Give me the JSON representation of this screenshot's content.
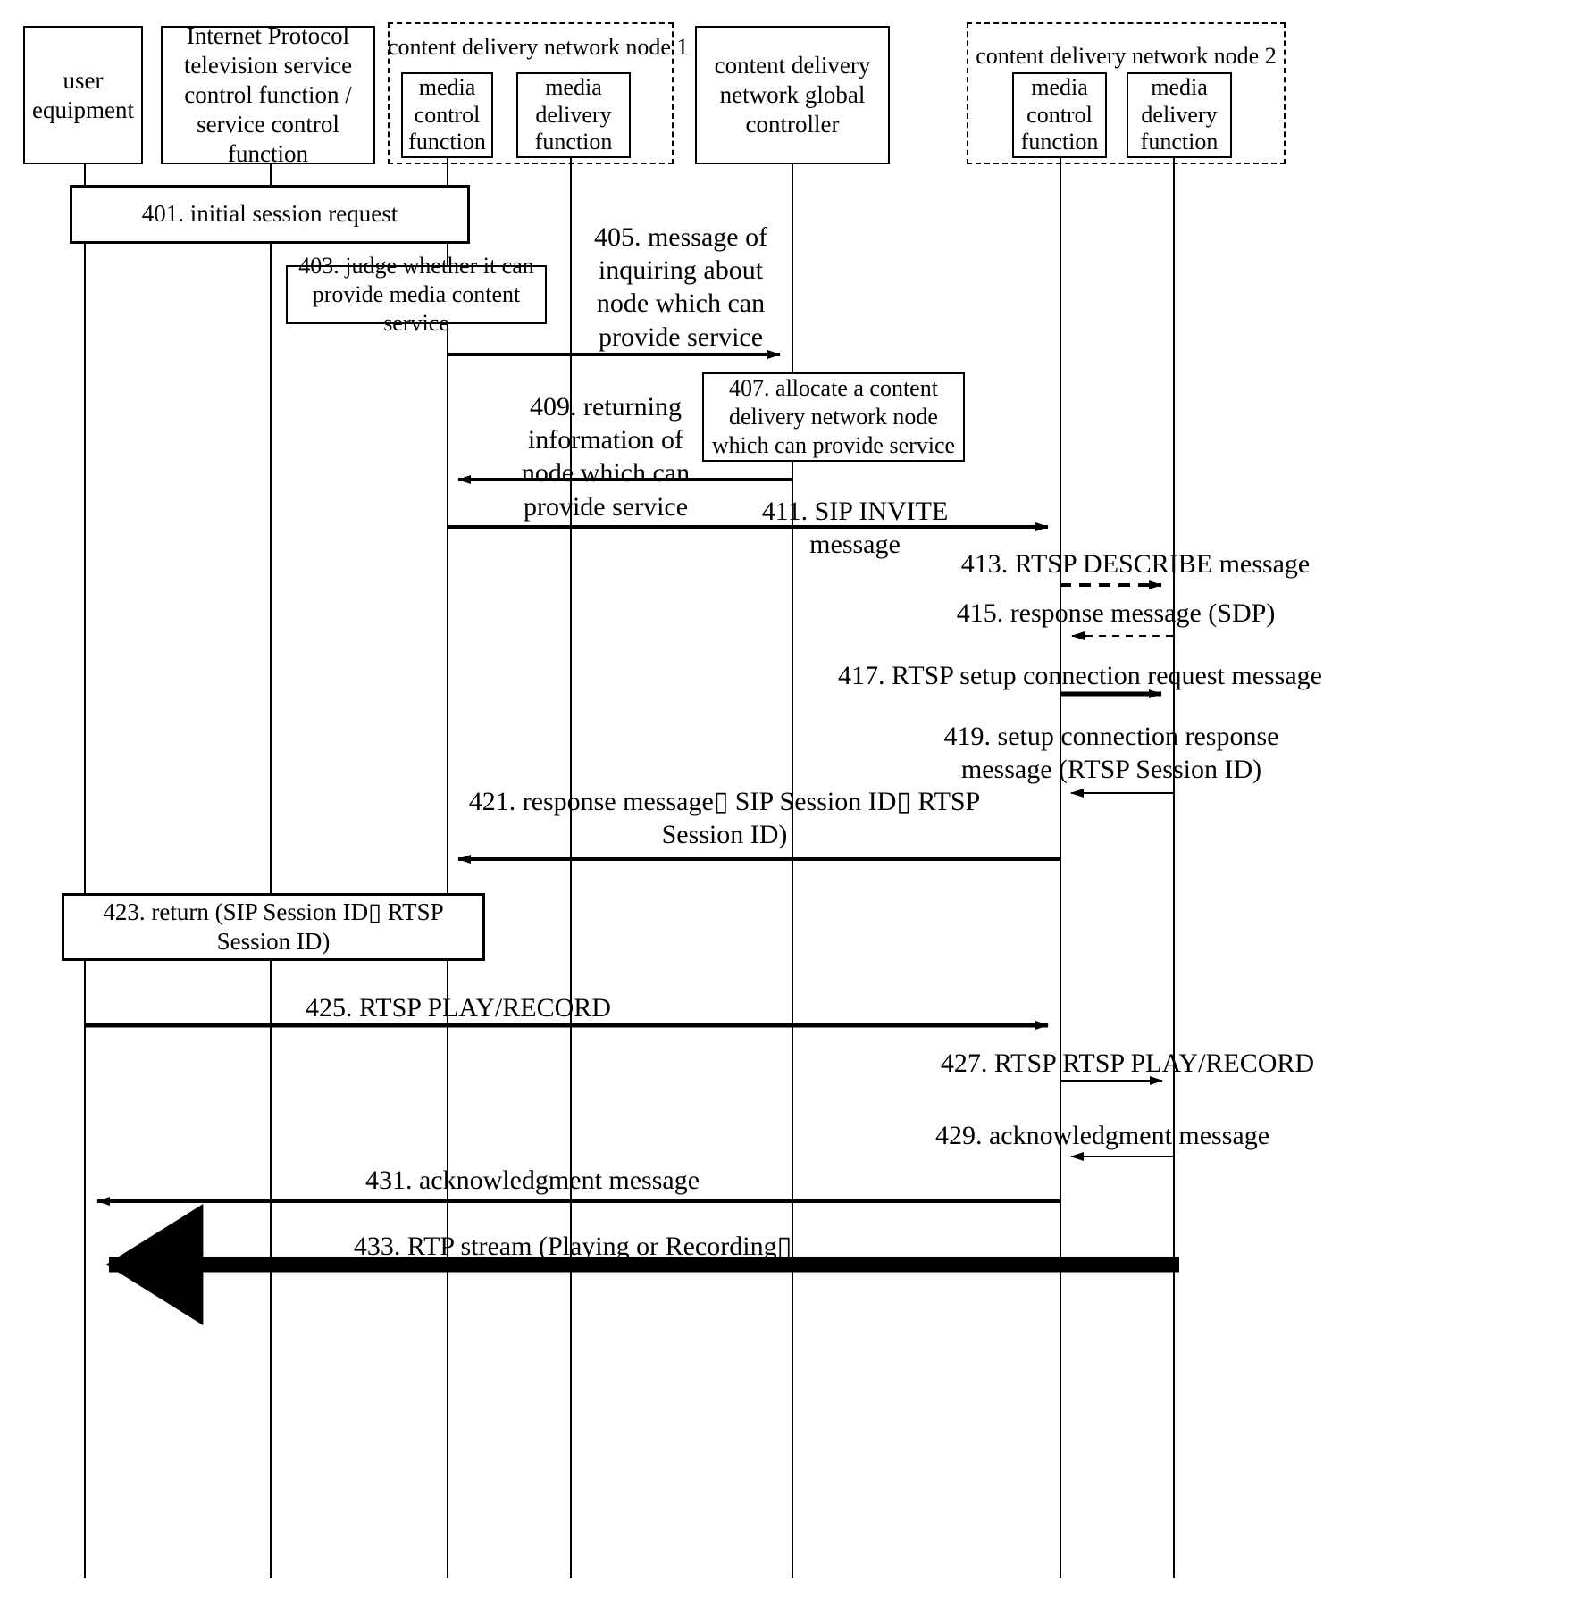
{
  "diagram": {
    "kind": "uml-sequence-diagram",
    "figure_label": "",
    "participants": [
      {
        "id": "ue",
        "label": "user\nequipment"
      },
      {
        "id": "iptv",
        "label": "Internet Protocol\ntelevision service\ncontrol function /\nservice control\nfunction"
      },
      {
        "id": "n1mcf",
        "label": "media\ncontrol\nfunction"
      },
      {
        "id": "n1mdf",
        "label": "media\ndelivery\nfunction"
      },
      {
        "id": "cdngc",
        "label": "content delivery\nnetwork global\ncontroller"
      },
      {
        "id": "n2mcf",
        "label": "media\ncontrol\nfunction"
      },
      {
        "id": "n2mdf",
        "label": "media\ndelivery\nfunction"
      }
    ],
    "groups": [
      {
        "id": "node1",
        "label": "content delivery network node 1"
      },
      {
        "id": "node2",
        "label": "content delivery network node 2"
      }
    ],
    "notes": [
      {
        "id": "n401",
        "label": "401. initial session request"
      },
      {
        "id": "n403",
        "label": "403. judge whether it can\nprovide media content service"
      },
      {
        "id": "n407",
        "label": "407. allocate a content\ndelivery network node\nwhich can provide service"
      },
      {
        "id": "n423",
        "label": "423. return (SIP Session ID▯ RTSP\nSession ID)"
      }
    ],
    "messages": [
      {
        "id": "m405",
        "label": "405. message of\ninquiring about\nnode which can\nprovide service",
        "style": "solid",
        "direction": "right"
      },
      {
        "id": "m409",
        "label": "409. returning\ninformation of\nnode which can\nprovide service",
        "style": "solid",
        "direction": "left"
      },
      {
        "id": "m411",
        "label": "411. SIP INVITE\nmessage",
        "style": "solid",
        "direction": "right"
      },
      {
        "id": "m413",
        "label": "413. RTSP DESCRIBE message",
        "style": "dashed",
        "direction": "right"
      },
      {
        "id": "m415",
        "label": "415. response message (SDP)",
        "style": "dashed-thin",
        "direction": "left"
      },
      {
        "id": "m417",
        "label": "417. RTSP setup connection request message",
        "style": "solid",
        "direction": "right"
      },
      {
        "id": "m419",
        "label": "419. setup connection response\nmessage (RTSP Session ID)",
        "style": "thin",
        "direction": "left"
      },
      {
        "id": "m421",
        "label": "421. response message▯  SIP Session ID▯  RTSP\nSession ID)",
        "style": "solid",
        "direction": "left"
      },
      {
        "id": "m425",
        "label": "425. RTSP PLAY/RECORD",
        "style": "solid",
        "direction": "right"
      },
      {
        "id": "m427",
        "label": "427. RTSP RTSP PLAY/RECORD",
        "style": "thin",
        "direction": "right"
      },
      {
        "id": "m429",
        "label": "429. acknowledgment message",
        "style": "thin",
        "direction": "left"
      },
      {
        "id": "m431",
        "label": "431. acknowledgment message",
        "style": "solid",
        "direction": "left"
      },
      {
        "id": "m433",
        "label": "433. RTP stream (Playing or Recording▯",
        "style": "heavy",
        "direction": "left"
      }
    ],
    "colors": {
      "stroke": "#000000",
      "background": "#ffffff"
    }
  }
}
